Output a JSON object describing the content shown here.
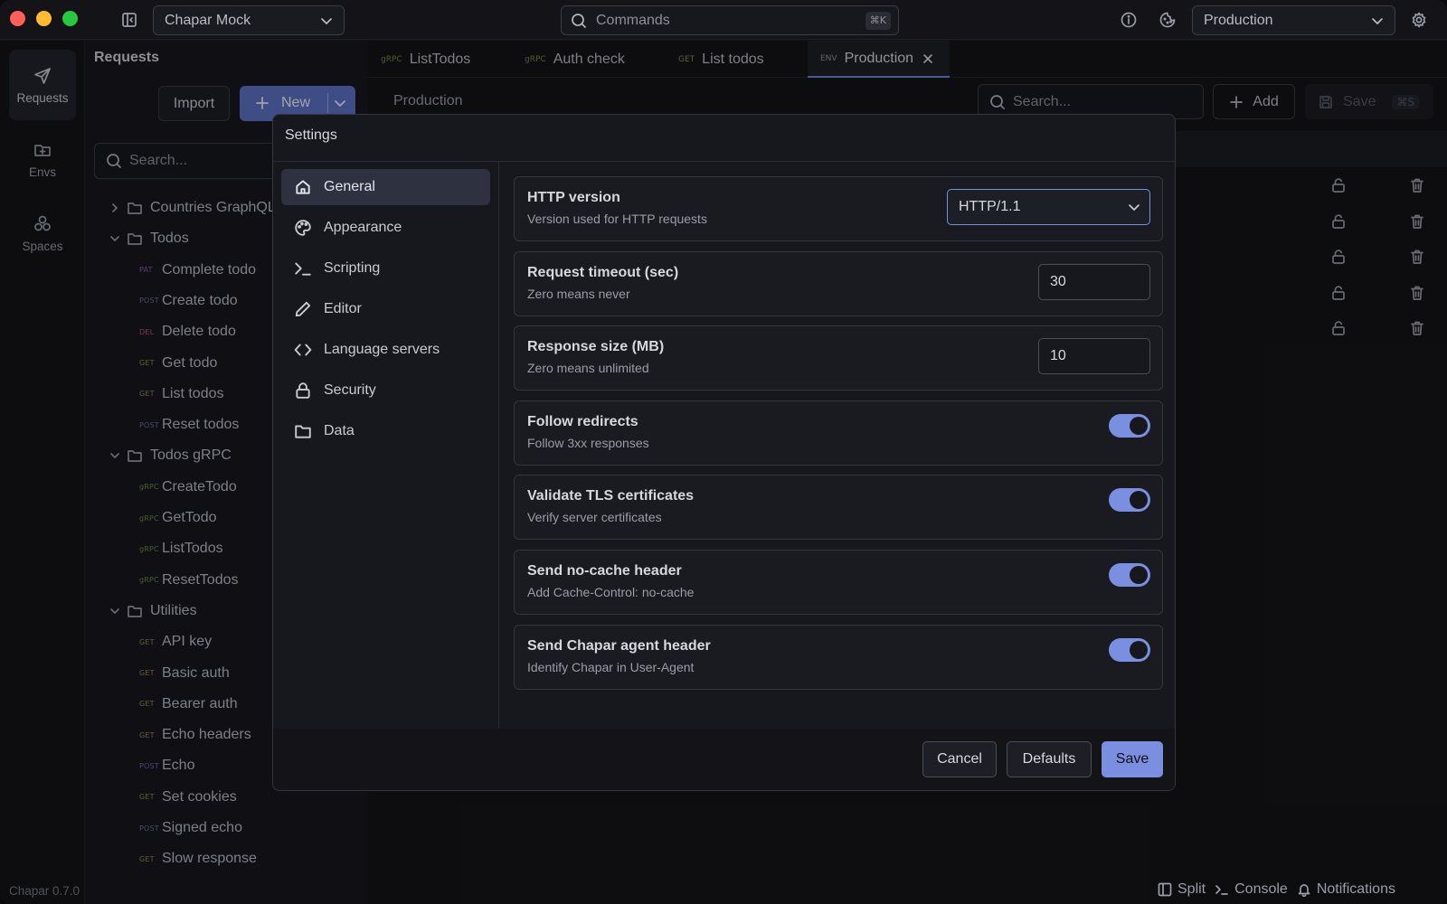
{
  "window": {
    "workspace": "Chapar Mock",
    "commands_placeholder": "Commands",
    "commands_shortcut": "⌘K",
    "environment": "Production"
  },
  "activity": {
    "items": [
      {
        "label": "Requests",
        "icon": "send-icon"
      },
      {
        "label": "Envs",
        "icon": "folder-plus-icon"
      },
      {
        "label": "Spaces",
        "icon": "cubes-icon"
      }
    ],
    "version": "Chapar 0.7.0"
  },
  "sidebar": {
    "title": "Requests",
    "import_label": "Import",
    "new_label": "New",
    "search_placeholder": "Search...",
    "tree": [
      {
        "type": "folder",
        "name": "Countries GraphQL",
        "open": false
      },
      {
        "type": "folder",
        "name": "Todos",
        "open": true
      },
      {
        "type": "req",
        "method": "PAT",
        "name": "Complete todo"
      },
      {
        "type": "req",
        "method": "POST",
        "name": "Create todo"
      },
      {
        "type": "req",
        "method": "DEL",
        "name": "Delete todo"
      },
      {
        "type": "req",
        "method": "GET",
        "name": "Get todo"
      },
      {
        "type": "req",
        "method": "GET",
        "name": "List todos"
      },
      {
        "type": "req",
        "method": "POST",
        "name": "Reset todos"
      },
      {
        "type": "folder",
        "name": "Todos gRPC",
        "open": true
      },
      {
        "type": "req",
        "method": "gRPC",
        "name": "CreateTodo"
      },
      {
        "type": "req",
        "method": "gRPC",
        "name": "GetTodo"
      },
      {
        "type": "req",
        "method": "gRPC",
        "name": "ListTodos"
      },
      {
        "type": "req",
        "method": "gRPC",
        "name": "ResetTodos"
      },
      {
        "type": "folder",
        "name": "Utilities",
        "open": true
      },
      {
        "type": "req",
        "method": "GET",
        "name": "API key"
      },
      {
        "type": "req",
        "method": "GET",
        "name": "Basic auth"
      },
      {
        "type": "req",
        "method": "GET",
        "name": "Bearer auth"
      },
      {
        "type": "req",
        "method": "GET",
        "name": "Echo headers"
      },
      {
        "type": "req",
        "method": "POST",
        "name": "Echo"
      },
      {
        "type": "req",
        "method": "GET",
        "name": "Set cookies"
      },
      {
        "type": "req",
        "method": "POST",
        "name": "Signed echo"
      },
      {
        "type": "req",
        "method": "GET",
        "name": "Slow response"
      }
    ]
  },
  "tabs": [
    {
      "tag": "gRPC",
      "label": "ListTodos"
    },
    {
      "tag": "gRPC",
      "label": "Auth check"
    },
    {
      "tag": "GET",
      "label": "List todos"
    },
    {
      "tag": "ENV",
      "label": "Production",
      "active": true
    }
  ],
  "main": {
    "title": "Production",
    "search_placeholder": "Search...",
    "add_label": "Add",
    "save_label": "Save",
    "save_shortcut": "⌘S"
  },
  "settings": {
    "title": "Settings",
    "nav": [
      {
        "label": "General",
        "icon": "home-icon",
        "active": true
      },
      {
        "label": "Appearance",
        "icon": "palette-icon"
      },
      {
        "label": "Scripting",
        "icon": "terminal-icon"
      },
      {
        "label": "Editor",
        "icon": "pencil-icon"
      },
      {
        "label": "Language servers",
        "icon": "code-icon"
      },
      {
        "label": "Security",
        "icon": "lock-icon"
      },
      {
        "label": "Data",
        "icon": "folder-icon"
      }
    ],
    "items": [
      {
        "title": "HTTP version",
        "desc": "Version used for HTTP requests",
        "control": "select",
        "value": "HTTP/1.1"
      },
      {
        "title": "Request timeout (sec)",
        "desc": "Zero means never",
        "control": "number",
        "value": "30"
      },
      {
        "title": "Response size (MB)",
        "desc": "Zero means unlimited",
        "control": "number",
        "value": "10"
      },
      {
        "title": "Follow redirects",
        "desc": "Follow 3xx responses",
        "control": "toggle",
        "on": true
      },
      {
        "title": "Validate TLS certificates",
        "desc": "Verify server certificates",
        "control": "toggle",
        "on": true
      },
      {
        "title": "Send no-cache header",
        "desc": "Add Cache-Control: no-cache",
        "control": "toggle",
        "on": true
      },
      {
        "title": "Send Chapar agent header",
        "desc": "Identify Chapar in User-Agent",
        "control": "toggle",
        "on": true
      }
    ],
    "cancel_label": "Cancel",
    "defaults_label": "Defaults",
    "save_label": "Save"
  },
  "statusbar": {
    "split": "Split",
    "console": "Console",
    "notifications": "Notifications"
  },
  "colors": {
    "accent": "#7b8fe0",
    "primary_button": "#5c72c4",
    "background": "#141418"
  }
}
